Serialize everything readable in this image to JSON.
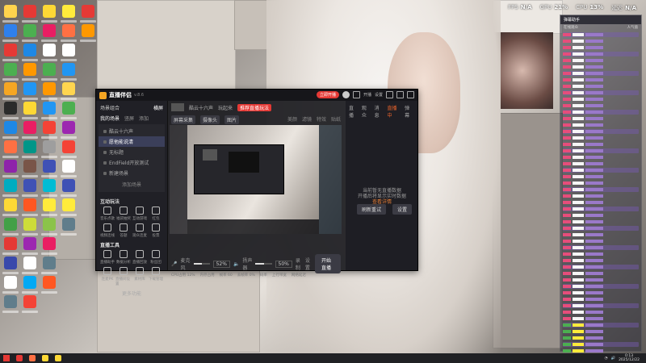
{
  "perf": {
    "fps_label": "FPS",
    "fps_value": "N/A",
    "gpu_label": "GPU",
    "gpu_value": "21%",
    "cpu_label": "CPU",
    "cpu_value": "13%",
    "delay_label": "延迟",
    "delay_value": "N/A"
  },
  "app": {
    "title": "直播伴侣",
    "version": "v.8.6",
    "promo_pill": "立即开播",
    "badge": "开播",
    "settings": "设置",
    "scene_header": "场景组合",
    "scene_mode": "横屏",
    "scene_tabs": [
      "我的场景",
      "竖屏",
      "添加"
    ],
    "scenes": [
      "酷云十六声",
      "愿他能说清",
      "无标题",
      "EndField开放测试",
      "新建场景"
    ],
    "add_scene": "添加场景",
    "interaction_title": "互动玩法",
    "interaction_tools": [
      "音乐点歌",
      "福袋抽奖",
      "互动游戏",
      "红包",
      "视频连线",
      "答题",
      "观众连麦",
      "投票"
    ],
    "anchor_tools_title": "直播工具",
    "anchor_tools": [
      "直播助手",
      "数据分析",
      "直播回放",
      "粉丝团",
      "连麦PK",
      "直播间设置",
      "素材库",
      "下载管理"
    ],
    "more_label": "更多功能",
    "center_tabs": [
      "酷云十六声",
      "玩起来"
    ],
    "center_hot": "推荐直播玩法",
    "center_row2": [
      "屏幕采集",
      "摄像头",
      "图片"
    ],
    "center_row2_right": [
      "美颜",
      "滤镜",
      "特效",
      "贴纸"
    ],
    "mic_label": "麦克风",
    "mic_pct": "52%",
    "speaker_label": "扬声器",
    "speaker_pct": "50%",
    "mic_level": 0.52,
    "speaker_level": 0.5,
    "right_icons": [
      "录制",
      "设置"
    ],
    "go_live": "开始直播",
    "status": [
      "CPU占用 12%",
      "内存占用",
      "帧率 60",
      "丢帧率 0%",
      "码率",
      "上行带宽",
      "网络延迟"
    ],
    "right_tabs": [
      "直播",
      "观众",
      "消息",
      "弹幕"
    ],
    "right_live_tab": "直播中",
    "right_msg_line1": "当前暂无直播数据",
    "right_msg_line2": "开播后将显示实时数据",
    "right_msg_link": "查看详情",
    "right_btn1": "刷新重试",
    "right_btn2": "设置"
  },
  "chat": {
    "header": "弹幕助手",
    "info_left": "在线观众",
    "info_right": "人气值"
  },
  "taskbar": {
    "time": "0:13",
    "date": "2025/12/22"
  },
  "colors": {
    "accent_red": "#e53935",
    "chat_pink": "#e64d7b",
    "chat_purple": "#9a79c9",
    "live_orange": "#f0652b"
  }
}
